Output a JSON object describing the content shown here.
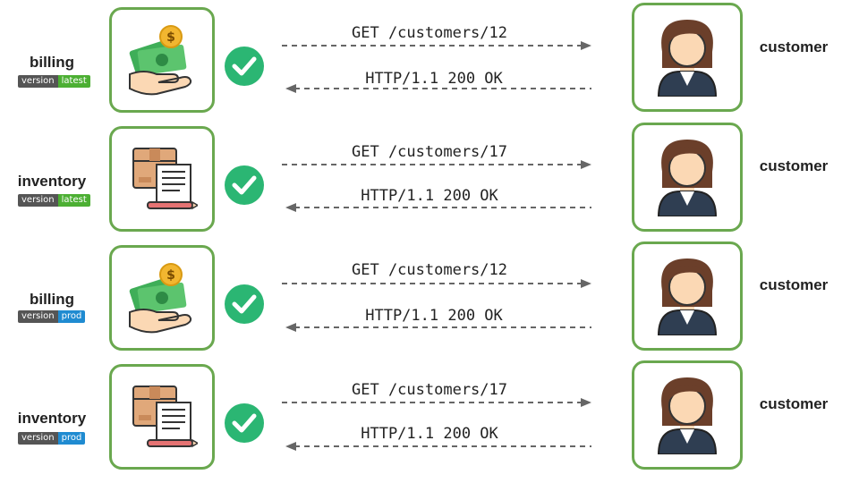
{
  "rows": [
    {
      "service": "billing",
      "icon": "money-hand-icon",
      "badge": {
        "left": "version",
        "right": "latest",
        "color": "#4caf33"
      },
      "request": "GET /customers/12",
      "response": "HTTP/1.1 200 OK",
      "target": "customer"
    },
    {
      "service": "inventory",
      "icon": "package-invoice-icon",
      "badge": {
        "left": "version",
        "right": "latest",
        "color": "#4caf33"
      },
      "request": "GET /customers/17",
      "response": "HTTP/1.1 200 OK",
      "target": "customer"
    },
    {
      "service": "billing",
      "icon": "money-hand-icon",
      "badge": {
        "left": "version",
        "right": "prod",
        "color": "#1f8bd1"
      },
      "request": "GET /customers/12",
      "response": "HTTP/1.1 200 OK",
      "target": "customer"
    },
    {
      "service": "inventory",
      "icon": "package-invoice-icon",
      "badge": {
        "left": "version",
        "right": "prod",
        "color": "#1f8bd1"
      },
      "request": "GET /customers/17",
      "response": "HTTP/1.1 200 OK",
      "target": "customer"
    }
  ],
  "colors": {
    "box_border": "#6aa84f",
    "check": "#2bb673",
    "arrow": "#666666"
  }
}
